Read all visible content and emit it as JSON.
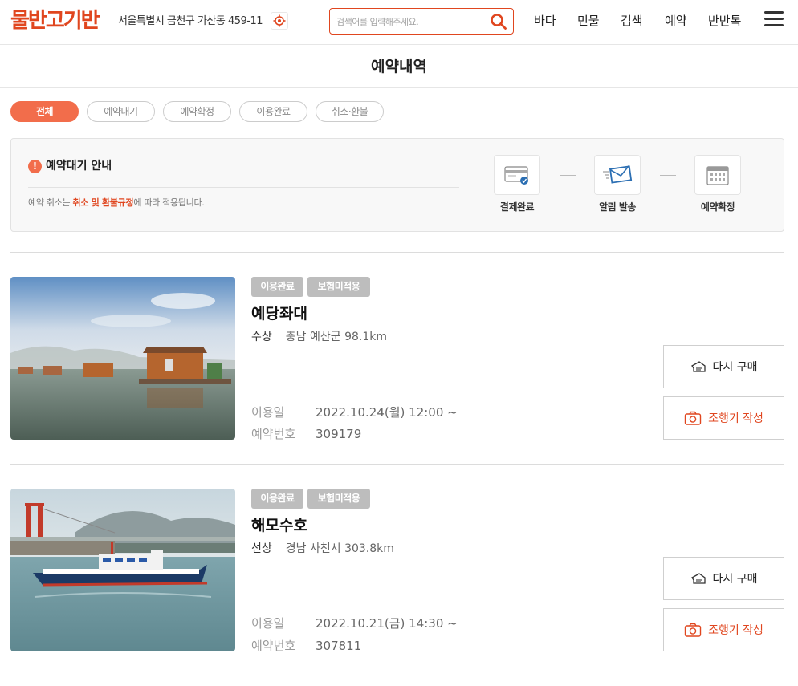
{
  "header": {
    "logo": "물반고기반",
    "address": "서울특별시 금천구 가산동 459-11",
    "search_placeholder": "검색어를 입력해주세요.",
    "nav": [
      "바다",
      "민물",
      "검색",
      "예약",
      "반반톡"
    ]
  },
  "page": {
    "title": "예약내역"
  },
  "filters": [
    "전체",
    "예약대기",
    "예약확정",
    "이용완료",
    "취소·환불"
  ],
  "notice": {
    "title": "예약대기 안내",
    "text_prefix": "예약 취소는 ",
    "text_highlight": "취소 및 환불규정",
    "text_suffix": "에 따라 적용됩니다.",
    "steps": [
      "결제완료",
      "알림 발송",
      "예약확정"
    ]
  },
  "labels": {
    "use_date": "이용일",
    "reservation_number": "예약번호",
    "rebuy": "다시 구매",
    "review": "조행기 작성"
  },
  "reservations": [
    {
      "badges": [
        "이용완료",
        "보험미적용"
      ],
      "name": "예당좌대",
      "type": "수상",
      "location": "충남 예산군 98.1km",
      "date": "2022.10.24(월) 12:00 ~",
      "number": "309179"
    },
    {
      "badges": [
        "이용완료",
        "보험미적용"
      ],
      "name": "해모수호",
      "type": "선상",
      "location": "경남 사천시 303.8km",
      "date": "2022.10.21(금) 14:30 ~",
      "number": "307811"
    }
  ],
  "colors": {
    "accent": "#e0461f",
    "chip_active": "#f26d4b",
    "badge": "#bdbdbd"
  }
}
